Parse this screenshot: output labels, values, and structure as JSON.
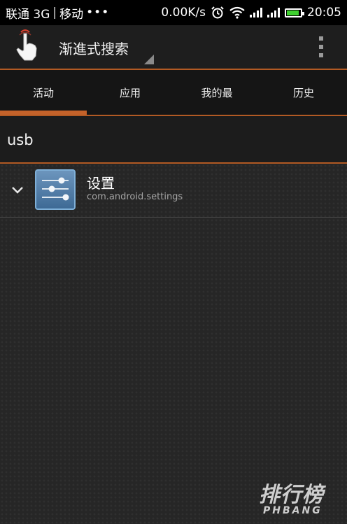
{
  "status_bar": {
    "carrier1": "联通 3G",
    "separator": "|",
    "carrier2": "移动",
    "dots": "•••",
    "speed": "0.00K/s",
    "time": "20:05",
    "icons": [
      "alarm-icon",
      "wifi-icon",
      "signal-icon",
      "signal-icon",
      "battery-icon"
    ]
  },
  "action_bar": {
    "title": "渐進式搜索",
    "icons": [
      "hand-pointer-icon",
      "spinner-triangle-icon",
      "overflow-menu-icon"
    ]
  },
  "tabs": [
    {
      "label": "活动",
      "selected": true
    },
    {
      "label": "应用",
      "selected": false
    },
    {
      "label": "我的最",
      "selected": false
    },
    {
      "label": "历史",
      "selected": false
    }
  ],
  "search": {
    "value": "usb"
  },
  "results": [
    {
      "title": "设置",
      "subtitle": "com.android.settings",
      "icon": "settings-sliders-icon"
    }
  ],
  "watermark": {
    "main": "排行榜",
    "sub": "PHBANG"
  },
  "colors": {
    "accent": "#c4622a",
    "background": "#262626",
    "status_bar": "#000000",
    "battery": "#3fd12f"
  }
}
